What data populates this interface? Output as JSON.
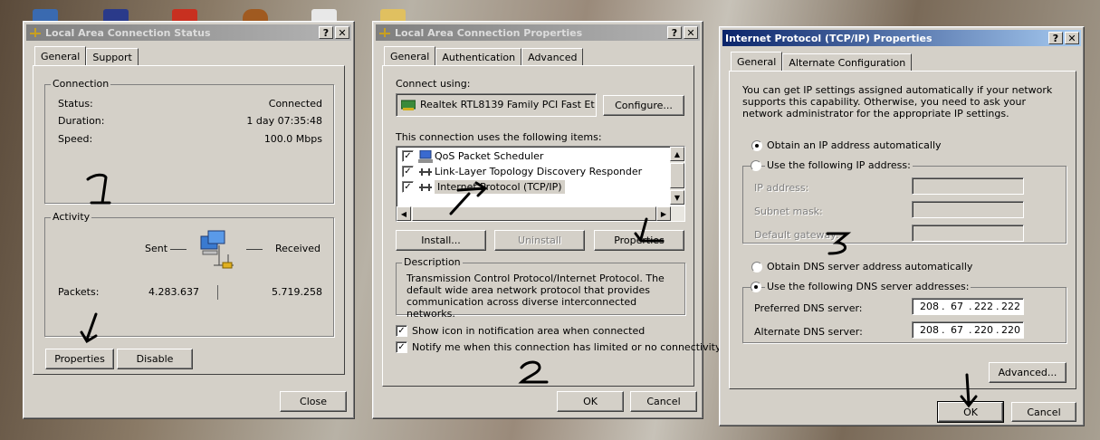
{
  "dialog1": {
    "title": "Local Area Connection Status",
    "tabs": [
      "General",
      "Support"
    ],
    "connection": {
      "legend": "Connection",
      "status_label": "Status:",
      "status_value": "Connected",
      "duration_label": "Duration:",
      "duration_value": "1 day 07:35:48",
      "speed_label": "Speed:",
      "speed_value": "100.0 Mbps"
    },
    "activity": {
      "legend": "Activity",
      "sent_label": "Sent",
      "received_label": "Received",
      "packets_label": "Packets:",
      "packets_sent": "4.283.637",
      "packets_received": "5.719.258"
    },
    "buttons": {
      "properties": "Properties",
      "disable": "Disable",
      "close": "Close"
    },
    "help": "?",
    "close_x": "✕"
  },
  "dialog2": {
    "title": "Local Area Connection Properties",
    "tabs": [
      "General",
      "Authentication",
      "Advanced"
    ],
    "connect_using_label": "Connect using:",
    "adapter": "Realtek RTL8139 Family PCI Fast Et",
    "configure_button": "Configure...",
    "items_label": "This connection uses the following items:",
    "items": [
      {
        "label": "QoS Packet Scheduler",
        "checked": true,
        "icon": "scheduler-icon"
      },
      {
        "label": "Link-Layer Topology Discovery Responder",
        "checked": true,
        "icon": "network-protocol-icon"
      },
      {
        "label": "Internet Protocol (TCP/IP)",
        "checked": true,
        "icon": "network-protocol-icon"
      }
    ],
    "buttons": {
      "install": "Install...",
      "uninstall": "Uninstall",
      "properties": "Properties",
      "ok": "OK",
      "cancel": "Cancel"
    },
    "description_legend": "Description",
    "description_text": "Transmission Control Protocol/Internet Protocol. The default wide area network protocol that provides communication across diverse interconnected networks.",
    "show_icon_label": "Show icon in notification area when connected",
    "notify_label": "Notify me when this connection has limited or no connectivity",
    "help": "?",
    "close_x": "✕"
  },
  "dialog3": {
    "title": "Internet Protocol (TCP/IP) Properties",
    "tabs": [
      "General",
      "Alternate Configuration"
    ],
    "intro": "You can get IP settings assigned automatically if your network supports this capability. Otherwise, you need to ask your network administrator for the appropriate IP settings.",
    "obtain_ip_auto": "Obtain an IP address automatically",
    "use_following_ip": "Use the following IP address:",
    "ip_address_label": "IP address:",
    "subnet_mask_label": "Subnet mask:",
    "default_gateway_label": "Default gateway:",
    "obtain_dns_auto": "Obtain DNS server address automatically",
    "use_following_dns": "Use the following DNS server addresses:",
    "preferred_dns_label": "Preferred DNS server:",
    "preferred_dns": [
      "208",
      "67",
      "222",
      "222"
    ],
    "alternate_dns_label": "Alternate DNS server:",
    "alternate_dns": [
      "208",
      "67",
      "220",
      "220"
    ],
    "buttons": {
      "advanced": "Advanced...",
      "ok": "OK",
      "cancel": "Cancel"
    },
    "help": "?",
    "close_x": "✕"
  },
  "annotations": {
    "step1": "1",
    "step2": "2",
    "step3": "3"
  },
  "colors": {
    "active_title": "#0a246a",
    "inactive_title": "#7f7f7f",
    "dialog_bg": "#d4d0c8"
  }
}
